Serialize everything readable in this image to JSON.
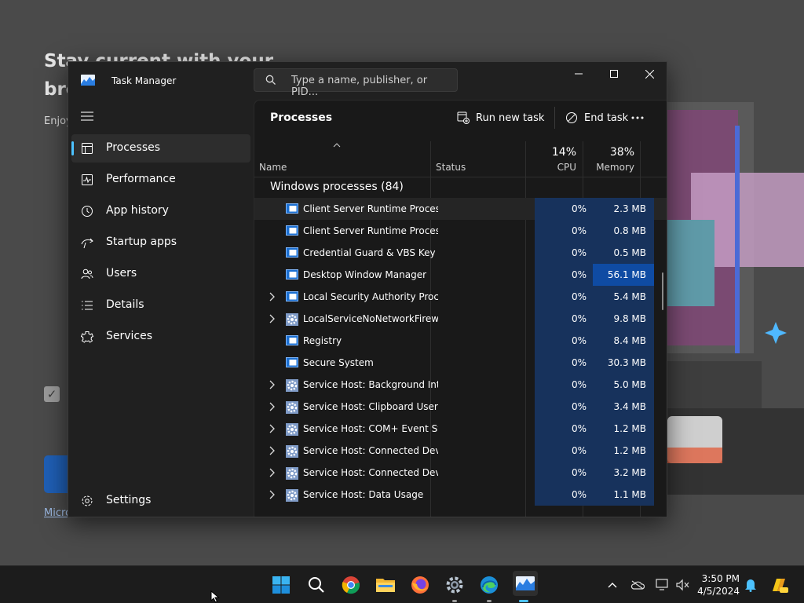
{
  "background": {
    "headline": "Stay current with your browsing data",
    "body": "Enjoy always more",
    "link": "Micro"
  },
  "titlebar": {
    "title": "Task Manager",
    "search_placeholder": "Type a name, publisher, or PID..."
  },
  "nav": {
    "items": [
      {
        "label": "Processes",
        "icon": "processes-icon",
        "active": true
      },
      {
        "label": "Performance",
        "icon": "performance-icon"
      },
      {
        "label": "App history",
        "icon": "app-history-icon"
      },
      {
        "label": "Startup apps",
        "icon": "startup-apps-icon"
      },
      {
        "label": "Users",
        "icon": "users-icon"
      },
      {
        "label": "Details",
        "icon": "details-icon"
      },
      {
        "label": "Services",
        "icon": "services-icon"
      }
    ],
    "settings": "Settings"
  },
  "toolbar": {
    "page_title": "Processes",
    "run_new_task": "Run new task",
    "end_task": "End task"
  },
  "columns": {
    "name": "Name",
    "status": "Status",
    "cpu_pct": "14%",
    "cpu": "CPU",
    "memory_pct": "38%",
    "memory": "Memory"
  },
  "group_label": "Windows processes (84)",
  "processes": [
    {
      "name": "Client Server Runtime Process",
      "cpu": "0%",
      "memory": "2.3 MB",
      "expandable": false,
      "icon": "window"
    },
    {
      "name": "Client Server Runtime Process",
      "cpu": "0%",
      "memory": "0.8 MB",
      "expandable": false,
      "icon": "window"
    },
    {
      "name": "Credential Guard & VBS Key Is...",
      "cpu": "0%",
      "memory": "0.5 MB",
      "expandable": false,
      "icon": "window"
    },
    {
      "name": "Desktop Window Manager",
      "cpu": "0%",
      "memory": "56.1 MB",
      "expandable": false,
      "icon": "window",
      "highlight": true
    },
    {
      "name": "Local Security Authority Proce...",
      "cpu": "0%",
      "memory": "5.4 MB",
      "expandable": true,
      "icon": "window"
    },
    {
      "name": "LocalServiceNoNetworkFirewa...",
      "cpu": "0%",
      "memory": "9.8 MB",
      "expandable": true,
      "icon": "gear"
    },
    {
      "name": "Registry",
      "cpu": "0%",
      "memory": "8.4 MB",
      "expandable": false,
      "icon": "window"
    },
    {
      "name": "Secure System",
      "cpu": "0%",
      "memory": "30.3 MB",
      "expandable": false,
      "icon": "window"
    },
    {
      "name": "Service Host: Background Inte...",
      "cpu": "0%",
      "memory": "5.0 MB",
      "expandable": true,
      "icon": "gear"
    },
    {
      "name": "Service Host: Clipboard User S...",
      "cpu": "0%",
      "memory": "3.4 MB",
      "expandable": true,
      "icon": "gear"
    },
    {
      "name": "Service Host: COM+ Event Sys...",
      "cpu": "0%",
      "memory": "1.2 MB",
      "expandable": true,
      "icon": "gear"
    },
    {
      "name": "Service Host: Connected Devi...",
      "cpu": "0%",
      "memory": "1.2 MB",
      "expandable": true,
      "icon": "gear"
    },
    {
      "name": "Service Host: Connected Devi...",
      "cpu": "0%",
      "memory": "3.2 MB",
      "expandable": true,
      "icon": "gear"
    },
    {
      "name": "Service Host: Data Usage",
      "cpu": "0%",
      "memory": "1.1 MB",
      "expandable": true,
      "icon": "gear"
    }
  ],
  "taskbar": {
    "apps": [
      "start-icon",
      "search-icon",
      "chrome-icon",
      "file-explorer-icon",
      "firefox-icon",
      "settings-icon",
      "edge-icon",
      "task-manager-icon"
    ],
    "time": "3:50 PM",
    "date": "4/5/2024"
  },
  "colors": {
    "accent": "#4cc2ff",
    "cpu_fill": "#17325c",
    "mem_highlight": "#0f4ba3"
  }
}
